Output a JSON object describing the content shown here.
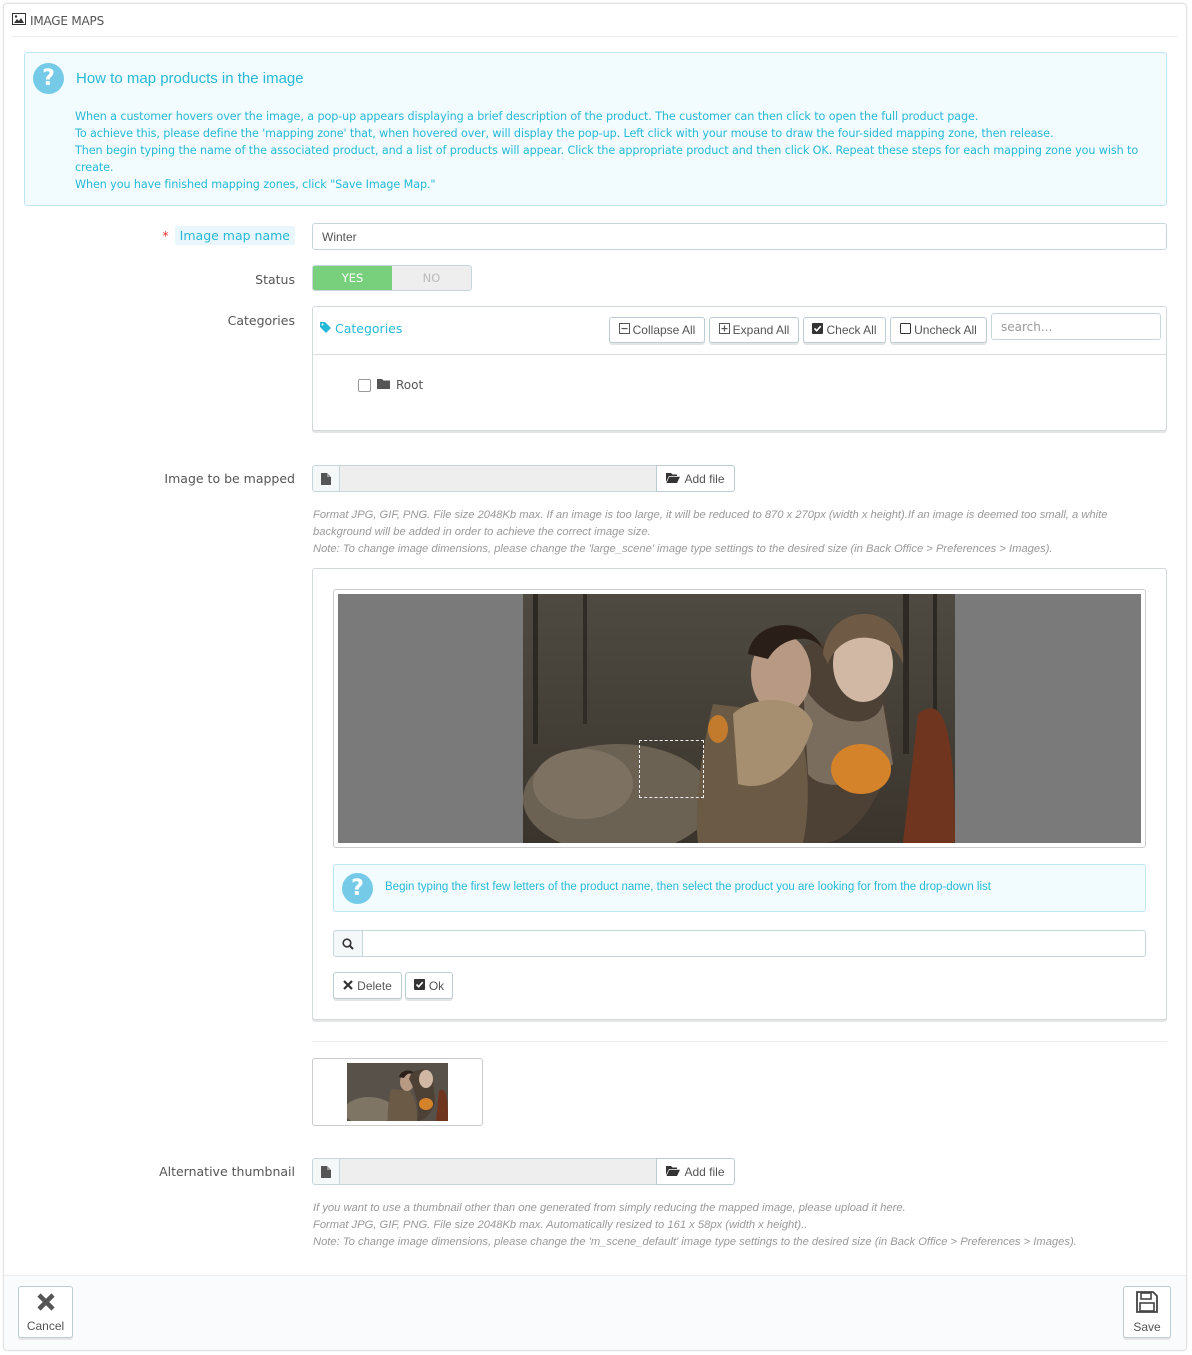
{
  "panel": {
    "title": "IMAGE MAPS",
    "title_icon": "picture-icon"
  },
  "info": {
    "title": "How to map products in the image",
    "lines": [
      "When a customer hovers over the image, a pop-up appears displaying a brief description of the product. The customer can then click to open the full product page.",
      "To achieve this, please define the 'mapping zone' that, when hovered over, will display the pop-up. Left click with your mouse to draw the four-sided mapping zone, then release.",
      "Then begin typing the name of the associated product, and a list of products will appear. Click the appropriate product and then click OK. Repeat these steps for each mapping zone you wish to create.",
      "When you have finished mapping zones, click \"Save Image Map.\""
    ]
  },
  "form": {
    "name_label": "Image map name",
    "name_value": "Winter",
    "status_label": "Status",
    "status_yes": "YES",
    "status_no": "NO",
    "status_value": "YES",
    "categories_label": "Categories",
    "tree": {
      "title": "Categories",
      "collapse_all": "Collapse All",
      "expand_all": "Expand All",
      "check_all": "Check All",
      "uncheck_all": "Uncheck All",
      "search_placeholder": "search...",
      "root_label": "Root"
    },
    "image_label": "Image to be mapped",
    "add_file": "Add file",
    "image_help": [
      "Format JPG, GIF, PNG. File size 2048Kb max. If an image is too large, it will be reduced to 870 x 270px (width x height).If an image is deemed too small, a white background will be added in order to achieve the correct image size.",
      "Note: To change image dimensions, please change the 'large_scene' image type settings to the desired size (in Back Office > Preferences > Images)."
    ],
    "mapper": {
      "help": "Begin typing the first few letters of the product name, then select the product you are looking for from the drop-down list",
      "delete": "Delete",
      "ok": "Ok"
    },
    "alt_thumb_label": "Alternative thumbnail",
    "alt_help": [
      "If you want to use a thumbnail other than one generated from simply reducing the mapped image, please upload it here.",
      "Format JPG, GIF, PNG. File size 2048Kb max. Automatically resized to 161 x 58px (width x height)..",
      "Note: To change image dimensions, please change the 'm_scene_default' image type settings to the desired size (in Back Office > Preferences > Images)."
    ]
  },
  "footer": {
    "cancel": "Cancel",
    "save": "Save"
  },
  "colors": {
    "accent": "#25b9d7",
    "success": "#78d07d",
    "info_bg": "#f2fbfe",
    "required": "#e62e2e"
  }
}
